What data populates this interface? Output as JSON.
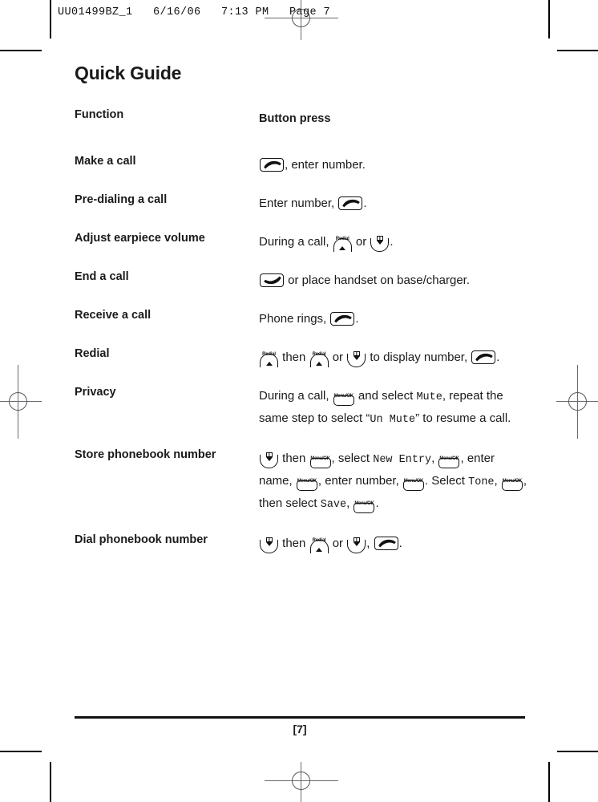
{
  "proof_header": "UU01499BZ_1   6/16/06   7:13 PM   Page 7",
  "page": {
    "title": "Quick Guide",
    "footer_page_number": "[7]"
  },
  "table": {
    "headers": {
      "function": "Function",
      "button_press": "Button press"
    },
    "rows": [
      {
        "function": "Make a call",
        "parts": [
          {
            "type": "key",
            "key": "talk"
          },
          {
            "type": "text",
            "text": ", enter number."
          }
        ]
      },
      {
        "function": "Pre-dialing a call",
        "parts": [
          {
            "type": "text",
            "text": "Enter number, "
          },
          {
            "type": "key",
            "key": "talk"
          },
          {
            "type": "text",
            "text": "."
          }
        ]
      },
      {
        "function": "Adjust earpiece volume",
        "parts": [
          {
            "type": "text",
            "text": "During a call, "
          },
          {
            "type": "key",
            "key": "redial-up"
          },
          {
            "type": "text",
            "text": " or "
          },
          {
            "type": "key",
            "key": "phonebook-down"
          },
          {
            "type": "text",
            "text": "."
          }
        ]
      },
      {
        "function": "End a call",
        "parts": [
          {
            "type": "key",
            "key": "end"
          },
          {
            "type": "text",
            "text": " or place handset on base/charger."
          }
        ]
      },
      {
        "function": "Receive a call",
        "parts": [
          {
            "type": "text",
            "text": "Phone rings, "
          },
          {
            "type": "key",
            "key": "talk"
          },
          {
            "type": "text",
            "text": "."
          }
        ]
      },
      {
        "function": "Redial",
        "parts": [
          {
            "type": "key",
            "key": "redial-up"
          },
          {
            "type": "text",
            "text": " then "
          },
          {
            "type": "key",
            "key": "redial-up"
          },
          {
            "type": "text",
            "text": " or "
          },
          {
            "type": "key",
            "key": "phonebook-down"
          },
          {
            "type": "text",
            "text": " to display number, "
          },
          {
            "type": "key",
            "key": "talk"
          },
          {
            "type": "text",
            "text": "."
          }
        ]
      },
      {
        "function": "Privacy",
        "parts": [
          {
            "type": "text",
            "text": "During a call, "
          },
          {
            "type": "key",
            "key": "menu-ok"
          },
          {
            "type": "text",
            "text": " and select "
          },
          {
            "type": "lcd",
            "text": "Mute"
          },
          {
            "type": "text",
            "text": ", repeat the same step to select “"
          },
          {
            "type": "lcd",
            "text": "Un Mute"
          },
          {
            "type": "text",
            "text": "” to resume a call."
          }
        ]
      },
      {
        "function": "Store phonebook number",
        "parts": [
          {
            "type": "key",
            "key": "phonebook-down"
          },
          {
            "type": "text",
            "text": " then "
          },
          {
            "type": "key",
            "key": "menu-ok"
          },
          {
            "type": "text",
            "text": ", select "
          },
          {
            "type": "lcd",
            "text": "New Entry"
          },
          {
            "type": "text",
            "text": ", "
          },
          {
            "type": "key",
            "key": "menu-ok"
          },
          {
            "type": "text",
            "text": ", enter name, "
          },
          {
            "type": "key",
            "key": "menu-ok"
          },
          {
            "type": "text",
            "text": ", enter number, "
          },
          {
            "type": "key",
            "key": "menu-ok"
          },
          {
            "type": "text",
            "text": ". Select "
          },
          {
            "type": "lcd",
            "text": "Tone"
          },
          {
            "type": "text",
            "text": ", "
          },
          {
            "type": "key",
            "key": "menu-ok"
          },
          {
            "type": "text",
            "text": ", then select "
          },
          {
            "type": "lcd",
            "text": "Save"
          },
          {
            "type": "text",
            "text": ", "
          },
          {
            "type": "key",
            "key": "menu-ok"
          },
          {
            "type": "text",
            "text": "."
          }
        ]
      },
      {
        "function": "Dial phonebook number",
        "parts": [
          {
            "type": "key",
            "key": "phonebook-down"
          },
          {
            "type": "text",
            "text": " then "
          },
          {
            "type": "key",
            "key": "redial-up"
          },
          {
            "type": "text",
            "text": " or "
          },
          {
            "type": "key",
            "key": "phonebook-down"
          },
          {
            "type": "text",
            "text": ", "
          },
          {
            "type": "key",
            "key": "talk"
          },
          {
            "type": "text",
            "text": "."
          }
        ]
      }
    ]
  },
  "keys": {
    "talk": {
      "icon": "talk-handset-icon",
      "label": ""
    },
    "end": {
      "icon": "end-call-handset-icon",
      "label": ""
    },
    "redial-up": {
      "icon": "redial-up-key-icon",
      "label": "Redial"
    },
    "phonebook-down": {
      "icon": "phonebook-down-key-icon",
      "label": ""
    },
    "menu-ok": {
      "icon": "menu-ok-key-icon",
      "label": "Menu/OK"
    }
  },
  "colors": {
    "ink": "#1a1a1a",
    "crop_mark": "#000000",
    "registration_mark": "#55555a"
  }
}
